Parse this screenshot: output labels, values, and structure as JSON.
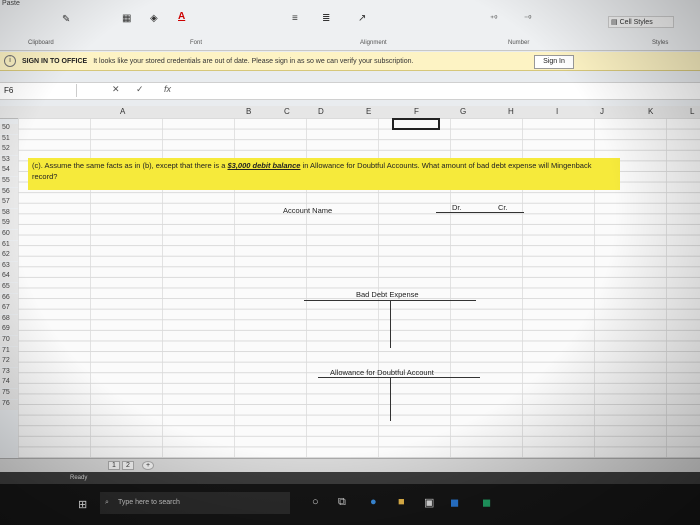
{
  "ribbon": {
    "paste_label": "Paste",
    "groups": {
      "clipboard": "Clipboard",
      "font": "Font",
      "alignment": "Alignment",
      "number": "Number",
      "styles": "Styles"
    },
    "cell_styles_label": "Cell Styles"
  },
  "message_bar": {
    "title": "SIGN IN TO OFFICE",
    "text": "It looks like your stored credentials are out of date. Please sign in as so we can verify your subscription.",
    "button": "Sign In"
  },
  "formula_bar": {
    "name_box": "F6",
    "fx_label": "fx",
    "value": ""
  },
  "columns": [
    "A",
    "B",
    "C",
    "D",
    "E",
    "F",
    "G",
    "H",
    "I",
    "J",
    "K",
    "L"
  ],
  "rows": [
    "50",
    "51",
    "52",
    "53",
    "54",
    "55",
    "56",
    "57",
    "58",
    "59",
    "60",
    "61",
    "62",
    "63",
    "64",
    "65",
    "66",
    "67",
    "68",
    "69",
    "70",
    "71",
    "72",
    "73",
    "74",
    "75",
    "76"
  ],
  "question": {
    "prefix": "(c). Assume the same facts as in (b), except that there is a ",
    "highlight": "$3,000 debit balance",
    "suffix": " in Allowance for Doubtful Accounts. What amount of bad debt expense will Mingenback record?"
  },
  "table": {
    "account_header": "Account Name",
    "dr_header": "Dr.",
    "cr_header": "Cr."
  },
  "t_accounts": [
    {
      "title": "Bad Debt Expense"
    },
    {
      "title": "Allowance for Doubtful Account"
    }
  ],
  "sheet_tabs": [
    "1",
    "2"
  ],
  "add_sheet": "+",
  "status_text": "Ready",
  "taskbar": {
    "search_placeholder": "Type here to search"
  }
}
